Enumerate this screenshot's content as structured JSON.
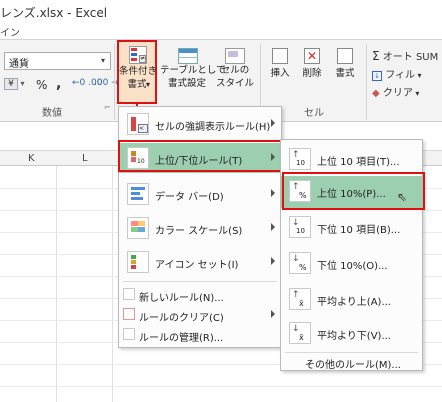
{
  "title_bar": {
    "title": "レンズ.xlsx - Excel"
  },
  "ribbon_tab_visible": "イン",
  "number_group": {
    "format_value": "通貨",
    "percent_symbol": "%",
    "comma_symbol": ",",
    "currency_symbol": "¥",
    "label": "数値"
  },
  "styles_group": {
    "conditional_formatting": "条件付き\n書式",
    "conditional_formatting_line1": "条件付き",
    "conditional_formatting_line2": "書式",
    "format_as_table_line1": "テーブルとして",
    "format_as_table_line2": "書式設定",
    "cell_styles_line1": "セルの",
    "cell_styles_line2": "スタイル"
  },
  "cells_group": {
    "insert": "挿入",
    "delete": "削除",
    "format": "書式",
    "label": "セル"
  },
  "editing_group": {
    "autosum": "オート SUM",
    "fill": "フィル",
    "clear": "クリア"
  },
  "column_headers": [
    "K",
    "L"
  ],
  "conditional_menu": {
    "items": [
      {
        "label": "セルの強調表示ルール(H)",
        "has_submenu": true,
        "icon": "highlight-cells-icon"
      },
      {
        "label": "上位/下位ルール(T)",
        "has_submenu": true,
        "icon": "top-bottom-rules-icon",
        "selected": true
      },
      {
        "label": "データ バー(D)",
        "has_submenu": true,
        "icon": "data-bars-icon"
      },
      {
        "label": "カラー スケール(S)",
        "has_submenu": true,
        "icon": "color-scales-icon"
      },
      {
        "label": "アイコン セット(I)",
        "has_submenu": true,
        "icon": "icon-sets-icon"
      }
    ],
    "small_items": [
      {
        "label": "新しいルール(N)...",
        "icon": "new-rule-icon"
      },
      {
        "label": "ルールのクリア(C)",
        "has_submenu": true,
        "icon": "clear-rules-icon"
      },
      {
        "label": "ルールの管理(R)...",
        "icon": "manage-rules-icon"
      }
    ]
  },
  "top_bottom_submenu": {
    "items": [
      {
        "label": "上位 10 項目(T)...",
        "icon": "top-10-items-icon"
      },
      {
        "label": "上位 10%(P)...",
        "icon": "top-10-percent-icon",
        "selected": true
      },
      {
        "label": "下位 10 項目(B)...",
        "icon": "bottom-10-items-icon"
      },
      {
        "label": "下位 10%(O)...",
        "icon": "bottom-10-percent-icon"
      },
      {
        "label": "平均より上(A)...",
        "icon": "above-average-icon"
      },
      {
        "label": "平均より下(V)...",
        "icon": "below-average-icon"
      }
    ],
    "more_rules": "その他のルール(M)..."
  },
  "colors": {
    "highlight": "#9ccfb0",
    "annotation_red": "#e01010"
  }
}
